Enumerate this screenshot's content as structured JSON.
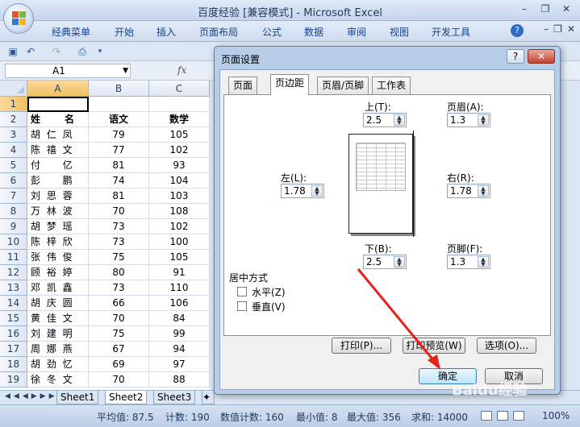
{
  "window": {
    "title": "百度经验 [兼容模式] - Microsoft Excel",
    "controls": [
      "–",
      "❐",
      "✕"
    ]
  },
  "ribbon": {
    "tabs": [
      "经典菜单",
      "开始",
      "插入",
      "页面布局",
      "公式",
      "数据",
      "审阅",
      "视图",
      "开发工具"
    ]
  },
  "formula_bar": {
    "name_box": "A1",
    "fx": "fx"
  },
  "grid": {
    "columns": [
      "A",
      "B",
      "C"
    ],
    "rows": [
      "1",
      "2",
      "3",
      "4",
      "5",
      "6",
      "7",
      "8",
      "9",
      "10",
      "11",
      "12",
      "13",
      "14",
      "15",
      "16",
      "17",
      "18",
      "19"
    ],
    "header": {
      "name": "姓　　名",
      "col1": "语文",
      "col2": "数学"
    },
    "data": [
      [
        "胡 仁 凤",
        "79",
        "105"
      ],
      [
        "陈 禧 文",
        "77",
        "102"
      ],
      [
        "付 　 亿",
        "81",
        "93"
      ],
      [
        "彭 　 鹏",
        "74",
        "104"
      ],
      [
        "刘 思 蓉",
        "81",
        "103"
      ],
      [
        "万 林 波",
        "70",
        "108"
      ],
      [
        "胡 梦 瑶",
        "73",
        "102"
      ],
      [
        "陈 梓 欣",
        "73",
        "100"
      ],
      [
        "张 伟 俊",
        "75",
        "105"
      ],
      [
        "顾 裕 婷",
        "80",
        "91"
      ],
      [
        "邓 凯 鑫",
        "73",
        "110"
      ],
      [
        "胡 庆 圆",
        "66",
        "106"
      ],
      [
        "黄 佳 文",
        "70",
        "84"
      ],
      [
        "刘 建 明",
        "75",
        "99"
      ],
      [
        "周 娜 燕",
        "67",
        "94"
      ],
      [
        "胡 劲 忆",
        "69",
        "97"
      ],
      [
        "徐 冬 文",
        "70",
        "88"
      ]
    ]
  },
  "sheets": [
    "Sheet1",
    "Sheet2",
    "Sheet3"
  ],
  "active_sheet": "Sheet2",
  "status": {
    "average": "平均值: 87.5",
    "count": "计数: 190",
    "numcount": "数值计数: 160",
    "min": "最小值: 8",
    "max": "最大值: 356",
    "sum": "求和: 14000",
    "zoom": "100%"
  },
  "dialog": {
    "title": "页面设置",
    "help": "?",
    "close": "✕",
    "tabs": [
      "页面",
      "页边距",
      "页眉/页脚",
      "工作表"
    ],
    "active_tab": "页边距",
    "top_label": "上(T):",
    "top_value": "2.5",
    "header_label": "页眉(A):",
    "header_value": "1.3",
    "left_label": "左(L):",
    "left_value": "1.78",
    "right_label": "右(R):",
    "right_value": "1.78",
    "bottom_label": "下(B):",
    "bottom_value": "2.5",
    "footer_label": "页脚(F):",
    "footer_value": "1.3",
    "center_group": "居中方式",
    "horizontal": "水平(Z)",
    "vertical": "垂直(V)",
    "print_btn": "打印(P)...",
    "preview_btn": "打印预览(W)",
    "options_btn": "选项(O)...",
    "ok_btn": "确定",
    "cancel_btn": "取消"
  },
  "watermark": "Baidu经验",
  "colors": {
    "arrow": "#e8201a",
    "accent": "#15428b"
  }
}
